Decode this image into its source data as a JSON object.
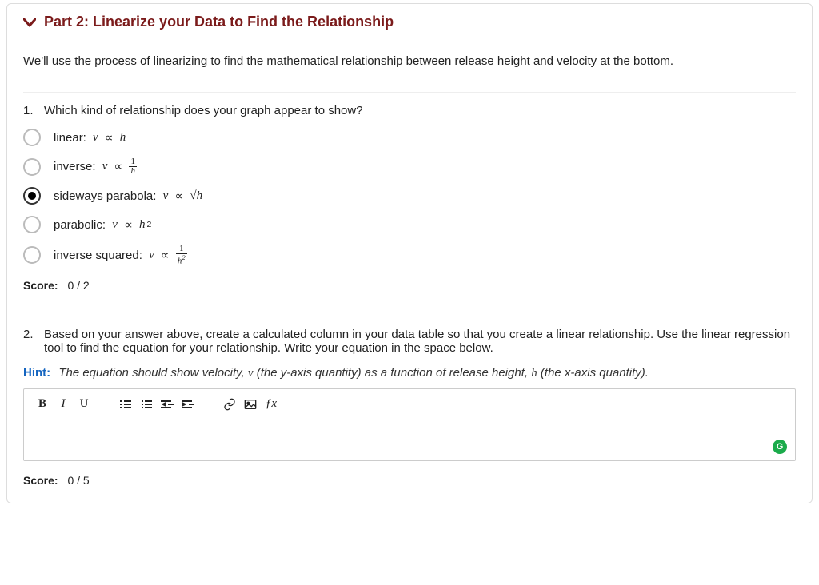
{
  "header": {
    "title": "Part 2: Linearize your Data to Find the Relationship"
  },
  "intro": "We'll use the process of linearizing to find the mathematical relationship between release height and velocity at the bottom.",
  "q1": {
    "number": "1.",
    "text": "Which kind of relationship does your graph appear to show?",
    "options": {
      "a": "linear:",
      "b": "inverse:",
      "c": "sideways parabola:",
      "d": "parabolic:",
      "e": "inverse squared:"
    },
    "score_label": "Score:",
    "score_value": "0 / 2"
  },
  "q2": {
    "number": "2.",
    "text": "Based on your answer above, create a calculated column in your data table so that you create a linear relationship. Use the linear regression tool to find the equation for your relationship. Write your equation in the space below.",
    "hint_label": "Hint:",
    "hint_text_1": "The equation should show velocity, ",
    "hint_v": "v",
    "hint_text_2": "  (the y-axis quantity) as a function of release height, ",
    "hint_h": "h",
    "hint_text_3": " (the x-axis quantity).",
    "score_label": "Score:",
    "score_value": "0 / 5"
  },
  "toolbar": {
    "bold": "B",
    "italic": "I",
    "underline": "U",
    "fx": "ƒx"
  },
  "grammarly": "G"
}
